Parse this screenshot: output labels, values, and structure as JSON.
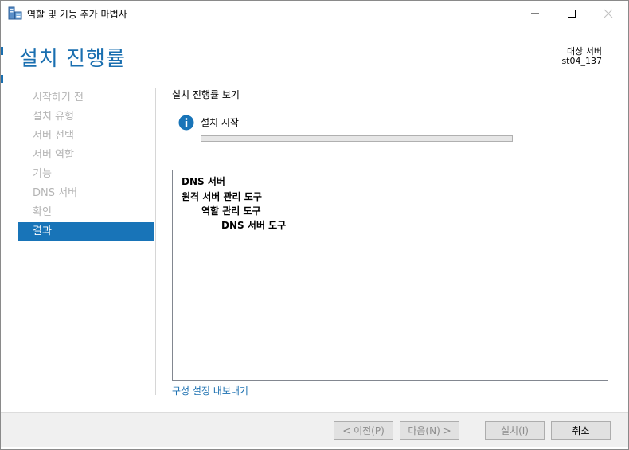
{
  "window": {
    "title": "역할 및 기능 추가 마법사"
  },
  "header": {
    "page_title": "설치 진행률",
    "target_label": "대상 서버",
    "target_value": "st04_137"
  },
  "nav": {
    "items": [
      {
        "label": "시작하기 전"
      },
      {
        "label": "설치 유형"
      },
      {
        "label": "서버 선택"
      },
      {
        "label": "서버 역할"
      },
      {
        "label": "기능"
      },
      {
        "label": "DNS 서버"
      },
      {
        "label": "확인"
      },
      {
        "label": "결과"
      }
    ],
    "active_index": 7
  },
  "main": {
    "section_heading": "설치 진행률 보기",
    "status_text": "설치 시작",
    "progress_fraction": 0.0,
    "results": [
      {
        "label": "DNS 서버",
        "level": 0
      },
      {
        "label": "원격 서버 관리 도구",
        "level": 0
      },
      {
        "label": "역할 관리 도구",
        "level": 1
      },
      {
        "label": "DNS 서버 도구",
        "level": 2
      }
    ],
    "export_link": "구성 설정 내보내기"
  },
  "footer": {
    "prev_label": "< 이전(P)",
    "next_label": "다음(N) >",
    "install_label": "설치(I)",
    "cancel_label": "취소"
  },
  "colors": {
    "accent": "#1a6fb0",
    "nav_active_bg": "#1874b8",
    "nav_inactive_text": "#b4b4b4",
    "info_icon": "#1874b8"
  },
  "icons": {
    "app": "server-manager-icon",
    "status": "info-icon"
  }
}
